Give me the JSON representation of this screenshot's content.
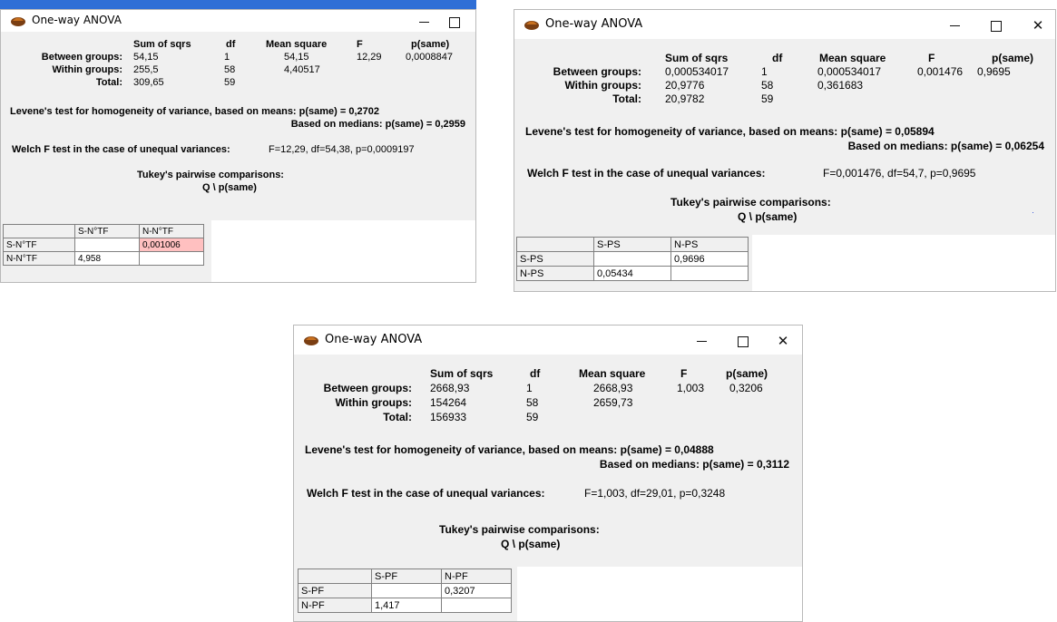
{
  "windows": [
    {
      "title": "One-way ANOVA",
      "headers": {
        "sum_of_sqrs": "Sum of sqrs",
        "df": "df",
        "mean_square": "Mean square",
        "f": "F",
        "p_same": "p(same)"
      },
      "rows": [
        {
          "label": "Between groups:",
          "ss": "54,15",
          "df": "1",
          "ms": "54,15",
          "f": "12,29",
          "p": "0,0008847"
        },
        {
          "label": "Within groups:",
          "ss": "255,5",
          "df": "58",
          "ms": "4,40517",
          "f": "",
          "p": ""
        },
        {
          "label": "Total:",
          "ss": "309,65",
          "df": "59",
          "ms": "",
          "f": "",
          "p": ""
        }
      ],
      "levene_means": "Levene's test for homogeneity of variance, based on means: p(same) = 0,2702",
      "levene_medians": "Based on medians: p(same) = 0,2959",
      "welch_label": "Welch F test in the case of unequal variances:",
      "welch_value": "F=12,29, df=54,38, p=0,0009197",
      "tukey_title": "Tukey's pairwise comparisons:",
      "tukey_subtitle": "Q \\ p(same)",
      "grid": {
        "columns": [
          "S-N°TF",
          "N-N°TF"
        ],
        "rows": [
          {
            "label": "S-N°TF",
            "cells": [
              "",
              "0,001006"
            ]
          },
          {
            "label": "N-N°TF",
            "cells": [
              "4,958",
              ""
            ]
          }
        ],
        "highlight_color": "#ffc0c0"
      }
    },
    {
      "title": "One-way ANOVA",
      "headers": {
        "sum_of_sqrs": "Sum of sqrs",
        "df": "df",
        "mean_square": "Mean square",
        "f": "F",
        "p_same": "p(same)"
      },
      "rows": [
        {
          "label": "Between groups:",
          "ss": "0,000534017",
          "df": "1",
          "ms": "0,000534017",
          "f": "0,001476",
          "p": "0,9695"
        },
        {
          "label": "Within groups:",
          "ss": "20,9776",
          "df": "58",
          "ms": "0,361683",
          "f": "",
          "p": ""
        },
        {
          "label": "Total:",
          "ss": "20,9782",
          "df": "59",
          "ms": "",
          "f": "",
          "p": ""
        }
      ],
      "levene_means": "Levene's test for homogeneity of variance, based on means: p(same) = 0,05894",
      "levene_medians": "Based on medians: p(same) = 0,06254",
      "welch_label": "Welch F test in the case of unequal variances:",
      "welch_value": "F=0,001476, df=54,7, p=0,9695",
      "tukey_title": "Tukey's pairwise comparisons:",
      "tukey_subtitle": "Q \\ p(same)",
      "grid": {
        "columns": [
          "S-PS",
          "N-PS"
        ],
        "rows": [
          {
            "label": "S-PS",
            "cells": [
              "",
              "0,9696"
            ]
          },
          {
            "label": "N-PS",
            "cells": [
              "0,05434",
              ""
            ]
          }
        ]
      }
    },
    {
      "title": "One-way ANOVA",
      "headers": {
        "sum_of_sqrs": "Sum of sqrs",
        "df": "df",
        "mean_square": "Mean square",
        "f": "F",
        "p_same": "p(same)"
      },
      "rows": [
        {
          "label": "Between groups:",
          "ss": "2668,93",
          "df": "1",
          "ms": "2668,93",
          "f": "1,003",
          "p": "0,3206"
        },
        {
          "label": "Within groups:",
          "ss": "154264",
          "df": "58",
          "ms": "2659,73",
          "f": "",
          "p": ""
        },
        {
          "label": "Total:",
          "ss": "156933",
          "df": "59",
          "ms": "",
          "f": "",
          "p": ""
        }
      ],
      "levene_means": "Levene's test for homogeneity of variance, based on means: p(same) = 0,04888",
      "levene_medians": "Based on medians: p(same) = 0,3112",
      "welch_label": "Welch F test in the case of unequal variances:",
      "welch_value": "F=1,003, df=29,01, p=0,3248",
      "tukey_title": "Tukey's pairwise comparisons:",
      "tukey_subtitle": "Q \\ p(same)",
      "grid": {
        "columns": [
          "S-PF",
          "N-PF"
        ],
        "rows": [
          {
            "label": "S-PF",
            "cells": [
              "",
              "0,3207"
            ]
          },
          {
            "label": "N-PF",
            "cells": [
              "1,417",
              ""
            ]
          }
        ]
      }
    }
  ],
  "window_controls": {
    "minimize": "minimize-icon",
    "maximize": "maximize-icon",
    "close": "close-icon",
    "close_glyph": "✕"
  },
  "colors": {
    "window_bg": "#f0f0f0",
    "title_bg": "#ffffff",
    "highlight": "#ffc0c0",
    "taskbar_blue": "#2f6fd6"
  }
}
